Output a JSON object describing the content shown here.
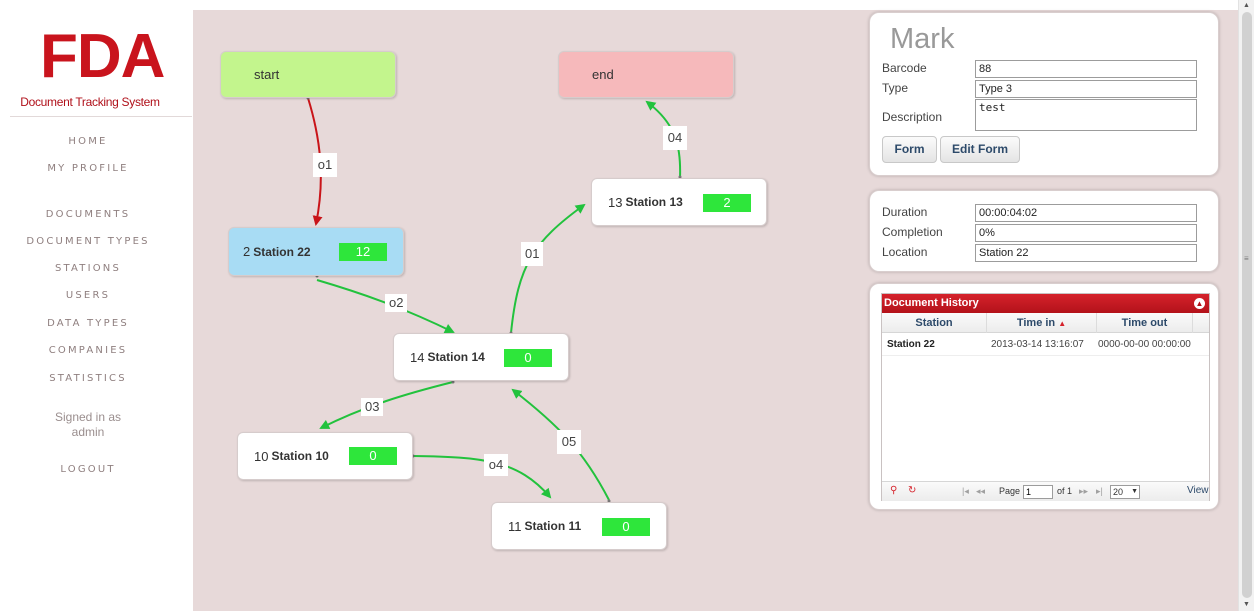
{
  "sidebar": {
    "logo": "FDA",
    "tagline": "Document Tracking System",
    "nav": {
      "home": "HOME",
      "my_profile": "MY PROFILE",
      "documents": "DOCUMENTS",
      "document_types": "DOCUMENT TYPES",
      "stations": "STATIONS",
      "users": "USERS",
      "data_types": "DATA TYPES",
      "companies": "COMPANIES",
      "statistics": "STATISTICS",
      "logout": "LOGOUT"
    },
    "signed_in_line1": "Signed in as",
    "signed_in_line2": "admin"
  },
  "flow": {
    "start_label": "start",
    "end_label": "end",
    "nodes": {
      "n2": {
        "number": "2",
        "name": "Station 22",
        "count": "12"
      },
      "n13": {
        "number": "13",
        "name": "Station 13",
        "count": "2"
      },
      "n14": {
        "number": "14",
        "name": "Station 14",
        "count": "0"
      },
      "n10": {
        "number": "10",
        "name": "Station 10",
        "count": "0"
      },
      "n11": {
        "number": "11",
        "name": "Station 11",
        "count": "0"
      }
    },
    "edges": {
      "start_to_2": "o1",
      "n2_to_14": "o2",
      "n14_to_13": "01",
      "n13_to_end": "04",
      "n14_to_10": "03",
      "n10_to_11": "o4",
      "n11_to_14": "05"
    },
    "colors": {
      "start": "#c3f58d",
      "end": "#f6b9bb",
      "current": "#a8dcf4",
      "count": "#2ee63b",
      "arrow_green": "#22c23d",
      "arrow_red": "#c91419"
    }
  },
  "mark": {
    "title": "Mark",
    "barcode_label": "Barcode",
    "barcode_value": "88",
    "type_label": "Type",
    "type_value": "Type 3",
    "description_label": "Description",
    "description_value": "test",
    "form_button": "Form",
    "edit_form_button": "Edit Form"
  },
  "status": {
    "duration_label": "Duration",
    "duration_value": "00:00:04:02",
    "completion_label": "Completion",
    "completion_value": "0%",
    "location_label": "Location",
    "location_value": "Station 22"
  },
  "history": {
    "title": "Document History",
    "columns": [
      "Station",
      "Time in",
      "Time out"
    ],
    "sort_indicator": "▲",
    "rows": [
      [
        "Station 22",
        "2013-03-14 13:16:07",
        "0000-00-00 00:00:00"
      ]
    ],
    "pager": {
      "page_label": "Page",
      "page_value": "1",
      "of_label": "of 1",
      "page_size": "20",
      "view_label": "View"
    }
  }
}
